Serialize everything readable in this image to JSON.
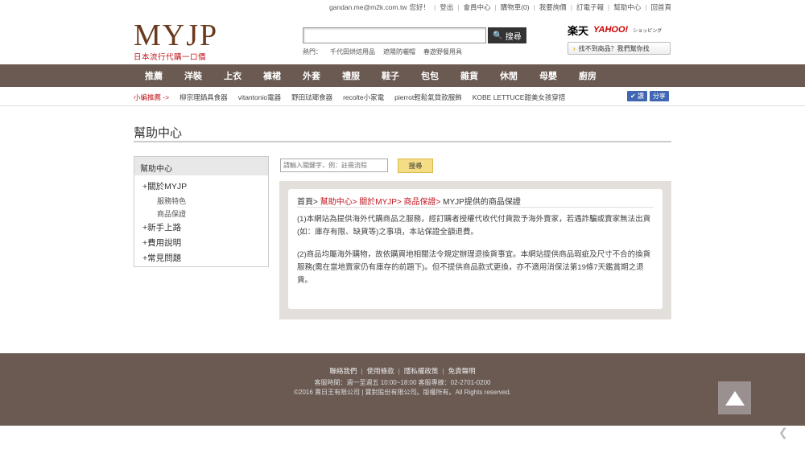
{
  "topbar": {
    "email": "gandan.me@m2k.com.tw",
    "greeting": "您好！",
    "links": [
      "登出",
      "會員中心",
      "購物車(0)",
      "我要詢價",
      "訂電子報",
      "幫助中心",
      "回首頁"
    ]
  },
  "logo": {
    "main": "MYJP",
    "sub": "日本流行代購一口價"
  },
  "search": {
    "button": "搜尋",
    "hot_label": "熱門：",
    "hot": [
      "千代田烘焙用品",
      "遮陽防曬帽",
      "春遊野餐用具"
    ]
  },
  "partners": {
    "rakuten": "楽天",
    "yahoo": "YAHOO!",
    "shopping": "ショッピング",
    "find": "找不到商品？我們幫你找"
  },
  "nav": [
    "推薦",
    "洋裝",
    "上衣",
    "褲裙",
    "外套",
    "禮服",
    "鞋子",
    "包包",
    "雜貨",
    "休閒",
    "母嬰",
    "廚房"
  ],
  "subbar": {
    "lead": "小編推薦 ->",
    "items": [
      "柳宗理鍋具食器",
      "vitantonio電器",
      "野田琺瑯食器",
      "recolte小家電",
      "pierrot輕鬆氣質款服飾",
      "KOBE LETTUCE甜美女孩穿搭"
    ],
    "share1": "讚",
    "share2": "分享"
  },
  "page_title": "幫助中心",
  "sidebar": {
    "head": "幫助中心",
    "items": [
      {
        "label": "+關於MYJP",
        "subs": [
          "服務特色",
          "商品保證"
        ]
      },
      {
        "label": "+新手上路",
        "subs": []
      },
      {
        "label": "+費用說明",
        "subs": []
      },
      {
        "label": "+常見問題",
        "subs": []
      }
    ]
  },
  "help_search": {
    "placeholder": "請輸入關鍵字，例：註冊流程",
    "button": "搜尋"
  },
  "breadcrumb": {
    "home": "首頁>",
    "c1": "幫助中心>",
    "c2": "關於MYJP>",
    "c3": "商品保證>",
    "current": "MYJP提供的商品保證"
  },
  "content": {
    "p1": "(1)本網站為提供海外代購商品之服務，經訂購者授權代收代付貨款予海外賣家，若遇詐騙或賣家無法出貨(如：庫存有限、缺貨等)之事項，本站保證全額退費。",
    "p2": "(2)商品均屬海外購物，故依購買地相關法令規定辦理退換貨事宜。本網站提供商品瑕疵及尺寸不合的換貨服務(需在當地賣家仍有庫存的前題下)。但不提供商品款式更換，亦不適用消保法第19條7天鑑賞期之退貨。"
  },
  "footer": {
    "links": [
      "聯絡我們",
      "使用條款",
      "隱私權政策",
      "免責聲明"
    ],
    "hours": "客服時間：週一至週五 10:00~18:00 客服專線：02-2701-0200",
    "copyright": "©2016 賣日王有限公司 | 寶對股份有限公司。版權所有。All Rights reserved."
  }
}
